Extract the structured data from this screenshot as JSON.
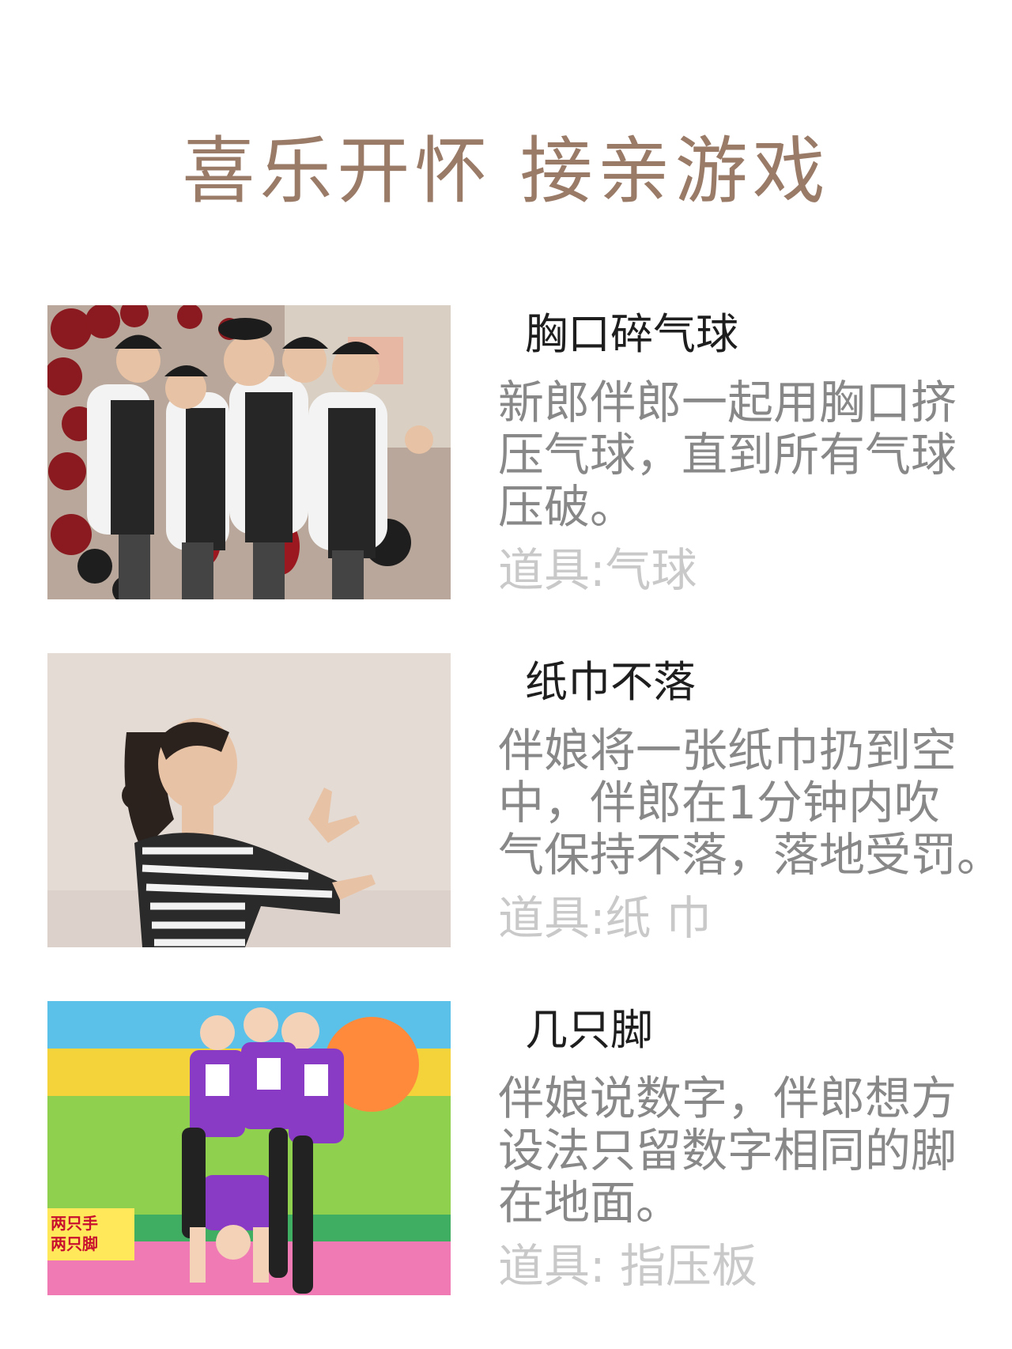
{
  "title": "喜乐开怀 接亲游戏",
  "games": [
    {
      "name": "胸口碎气球",
      "description_lines": [
        "新郎伴郎一起用胸口挤",
        "压气球，直到所有气球",
        "压破。"
      ],
      "prop": "道具:气球",
      "photo_icon": "groomsmen-balloons-photo"
    },
    {
      "name": "纸巾不落",
      "description_lines": [
        "伴娘将一张纸巾扔到空",
        "中，伴郎在1分钟内吹",
        "气保持不落，落地受罚。"
      ],
      "prop": "道具:纸 巾",
      "photo_icon": "woman-blowing-tissue-photo"
    },
    {
      "name": "几只脚",
      "description_lines": [
        "伴娘说数字，伴郎想方",
        "设法只留数字相同的脚",
        "在地面。"
      ],
      "prop": "道具: 指压板",
      "photo_icon": "tv-show-feet-game-photo"
    }
  ],
  "photo3_caption_lines": [
    "两只手",
    "两只脚"
  ],
  "colors": {
    "title": "#9a7b68",
    "name": "#1e1e1e",
    "description": "#888888",
    "prop": "#c9c9c9"
  }
}
